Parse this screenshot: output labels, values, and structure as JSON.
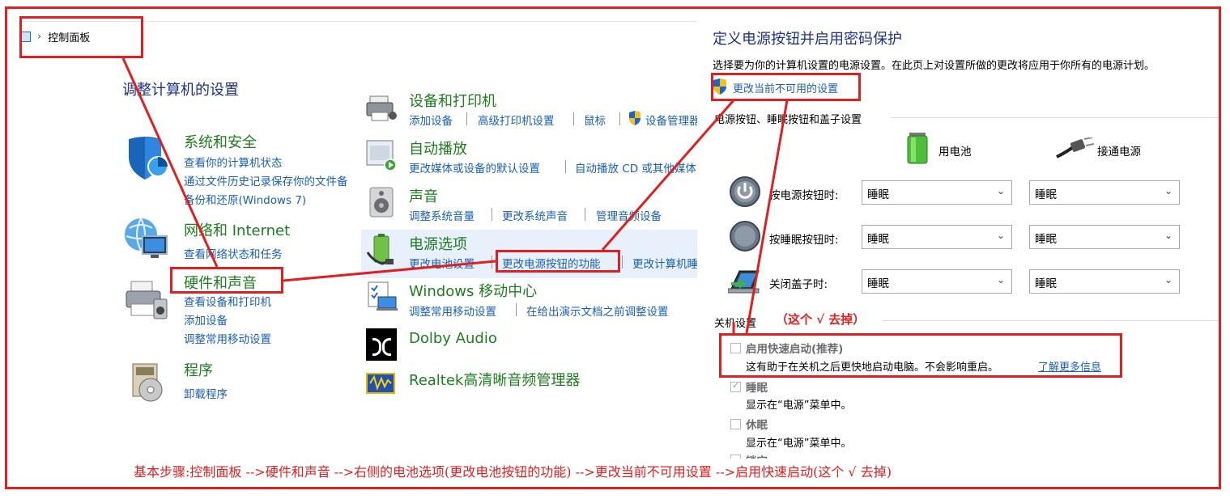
{
  "breadcrumb": {
    "label": "控制面板"
  },
  "cp": {
    "heading": "调整计算机的设置",
    "left": [
      {
        "title": "系统和安全",
        "links": [
          "查看你的计算机状态",
          "通过文件历史记录保存你的文件备",
          "备份和还原(Windows 7)"
        ]
      },
      {
        "title": "网络和 Internet",
        "links": [
          "查看网络状态和任务"
        ]
      },
      {
        "title": "硬件和声音",
        "links": [
          "查看设备和打印机",
          "添加设备",
          "调整常用移动设置"
        ]
      },
      {
        "title": "程序",
        "links": [
          "卸载程序"
        ]
      }
    ],
    "right": [
      {
        "title": "设备和打印机",
        "links": [
          "添加设备",
          "高级打印机设置",
          "鼠标",
          "设备管理器"
        ]
      },
      {
        "title": "自动播放",
        "links": [
          "更改媒体或设备的默认设置",
          "自动播放 CD 或其他媒体"
        ]
      },
      {
        "title": "声音",
        "links": [
          "调整系统音量",
          "更改系统声音",
          "管理音频设备"
        ]
      },
      {
        "title": "电源选项",
        "links": [
          "更改电池设置",
          "更改电源按钮的功能",
          "更改计算机睡"
        ]
      },
      {
        "title": "Windows 移动中心",
        "links": [
          "调整常用移动设置",
          "在给出演示文档之前调整设置"
        ]
      },
      {
        "title": "Dolby Audio",
        "links": []
      },
      {
        "title": "Realtek高清晰音频管理器",
        "links": []
      }
    ]
  },
  "power": {
    "title": "定义电源按钮并启用密码保护",
    "desc": "选择要为你的计算机设置的电源设置。在此页上对设置所做的更改将应用于你所有的电源计划。",
    "change_link": "更改当前不可用的设置",
    "section1": "电源按钮、睡眠按钮和盖子设置",
    "col_battery": "用电池",
    "col_plugged": "接通电源",
    "rows": [
      {
        "label": "按电源按钮时:",
        "battery": "睡眠",
        "plugged": "睡眠"
      },
      {
        "label": "按睡眠按钮时:",
        "battery": "睡眠",
        "plugged": "睡眠"
      },
      {
        "label": "关闭盖子时:",
        "battery": "睡眠",
        "plugged": "睡眠"
      }
    ],
    "section2": "关机设置",
    "fast_startup": {
      "label": "启用快速启动(推荐)",
      "desc": "这有助于在关机之后更快地启动电脑。不会影响重启。",
      "link": "了解更多信息",
      "checked": false
    },
    "sleep": {
      "label": "睡眠",
      "desc": "显示在“电源”菜单中。",
      "checked": true
    },
    "hibernate": {
      "label": "休眠",
      "desc": "显示在“电源”菜单中。",
      "checked": false
    },
    "lock_partial": "锁定"
  },
  "annotations": {
    "uncheck_note": "（这个 √ 去掉）",
    "steps": "基本步骤:控制面板 -->硬件和声音 -->右侧的电池选项(更改电池按钮的功能) -->更改当前不可用设置 -->启用快速启动(这个 √ 去掉)"
  }
}
